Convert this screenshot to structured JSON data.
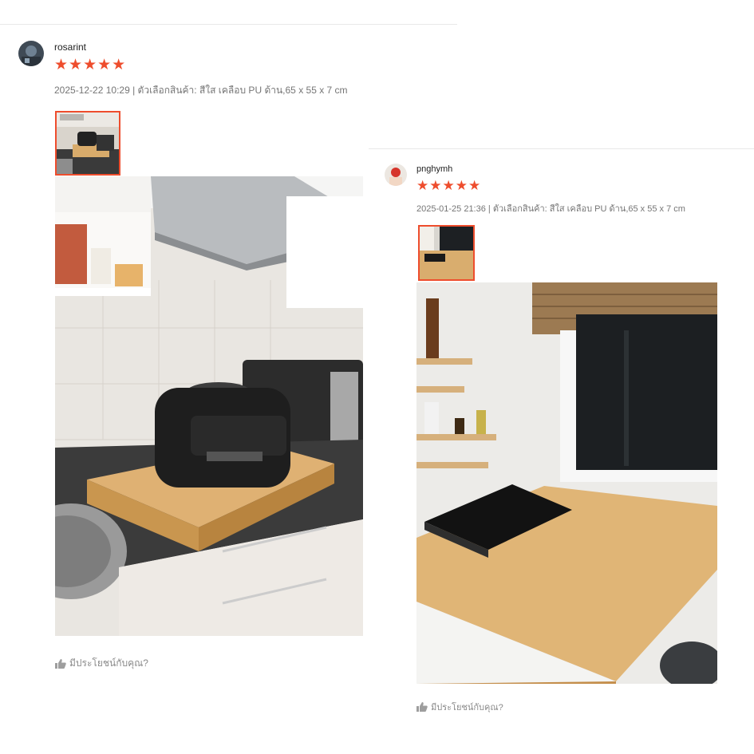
{
  "reviews": [
    {
      "username": "rosarint",
      "rating": 5,
      "stars": "★★★★★",
      "meta": "2025-12-22 10:29 | ตัวเลือกสินค้า: สีใส เคลือบ PU ด้าน,65 x 55 x 7 cm",
      "photo_icon": "review-photo-kitchen-airfryer",
      "helpful": "มีประโยชน์กับคุณ?"
    },
    {
      "username": "pnghymh",
      "rating": 5,
      "stars": "★★★★★",
      "meta": "2025-01-25 21:36 | ตัวเลือกสินค้า: สีใส เคลือบ PU ด้าน,65 x 55 x 7 cm",
      "photo_icon": "review-photo-induction-cooker",
      "helpful": "มีประโยชน์กับคุณ?"
    }
  ],
  "colors": {
    "star": "#ee4d2d",
    "thumb_border": "#ee4d2d",
    "wood": "#d9a86a",
    "muted_text": "#757575"
  }
}
